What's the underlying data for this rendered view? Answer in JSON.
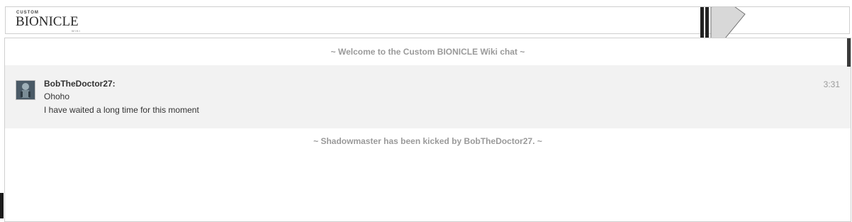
{
  "header": {
    "logo_small": "CUSTOM",
    "logo_main": "BIONICLE",
    "logo_sub": "WIKI"
  },
  "chat": {
    "welcome": "~ Welcome to the Custom BIONICLE Wiki chat ~",
    "messages": [
      {
        "user": "BobTheDoctor27:",
        "lines": [
          "Ohoho",
          "I have waited a long time for this moment"
        ],
        "time": "3:31"
      }
    ],
    "kick_alert": "~ Shadowmaster has been kicked by BobTheDoctor27. ~"
  },
  "icons": {
    "avatar": "user-avatar",
    "decoration": "arrow-graphic-icon"
  }
}
